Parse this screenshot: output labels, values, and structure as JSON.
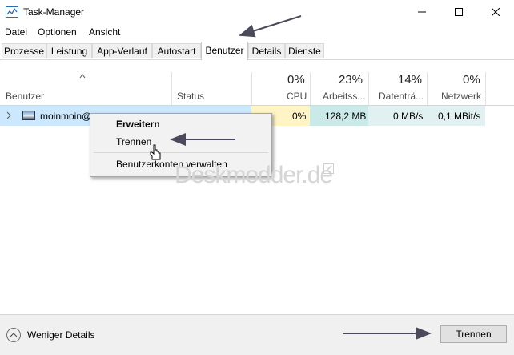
{
  "window": {
    "title": "Task-Manager"
  },
  "menu": [
    "Datei",
    "Optionen",
    "Ansicht"
  ],
  "tabs": [
    {
      "label": "Prozesse"
    },
    {
      "label": "Leistung"
    },
    {
      "label": "App-Verlauf"
    },
    {
      "label": "Autostart"
    },
    {
      "label": "Benutzer"
    },
    {
      "label": "Details"
    },
    {
      "label": "Dienste"
    }
  ],
  "active_tab": "Benutzer",
  "columns": {
    "benutzer": {
      "label": "Benutzer"
    },
    "status": {
      "label": "Status"
    },
    "cpu": {
      "percent": "0%",
      "label": "CPU"
    },
    "arbeitsspeicher": {
      "percent": "23%",
      "label": "Arbeitss..."
    },
    "datentraeger": {
      "percent": "14%",
      "label": "Datenträ..."
    },
    "netzwerk": {
      "percent": "0%",
      "label": "Netzwerk"
    }
  },
  "rows": [
    {
      "user": "moinmoin@",
      "cpu": "0%",
      "memory": "128,2 MB",
      "disk": "0 MB/s",
      "network": "0,1 MBit/s"
    }
  ],
  "context_menu": {
    "items": [
      "Erweitern",
      "Trennen",
      "Benutzerkonten verwalten"
    ]
  },
  "watermark": "Deskmodder.de",
  "footer": {
    "less_details": "Weniger Details",
    "disconnect_button": "Trennen"
  },
  "colors": {
    "row_highlight": "#cce8ff",
    "cpu_cell": "#fff4c4",
    "memory_cell": "#cae9e9",
    "other_cells": "#e1f0f0",
    "arrows": "#4a4a5a"
  },
  "icons": [
    "task-manager-app-icon",
    "minimize-icon",
    "maximize-icon",
    "close-icon",
    "sort-up-icon",
    "chevron-right-icon",
    "user-avatar-icon",
    "chevron-up-icon",
    "mouse-cursor-icon",
    "pencil-icon"
  ]
}
